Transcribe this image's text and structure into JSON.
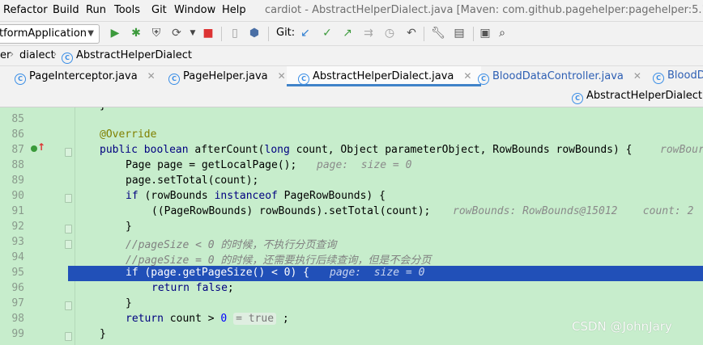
{
  "menu": [
    "Refactor",
    "Build",
    "Run",
    "Tools",
    "Git",
    "Window",
    "Help"
  ],
  "title": "cardiot - AbstractHelperDialect.java [Maven: com.github.pagehelper:pagehelper:5.1.4]",
  "toolbar": {
    "run_config": "tformApplication",
    "git_label": "Git:"
  },
  "breadcrumb": [
    "er",
    "dialect",
    "AbstractHelperDialect"
  ],
  "tabs": [
    {
      "label": "PageInterceptor.java"
    },
    {
      "label": "PageHelper.java"
    },
    {
      "label": "AbstractHelperDialect.java"
    },
    {
      "label": "BloodDataController.java"
    },
    {
      "label": "BloodD"
    }
  ],
  "subbar_file": "AbstractHelperDialect.cla",
  "editor": {
    "line_numbers": [
      "85",
      "86",
      "87",
      "88",
      "89",
      "90",
      "91",
      "92",
      "93",
      "94",
      "95",
      "96",
      "97",
      "98",
      "99"
    ],
    "lines": {
      "l86_ann": "@Override",
      "l87_a": "public boolean",
      "l87_b": " afterCount(",
      "l87_c": "long",
      "l87_d": " count, Object parameterObject, RowBounds rowBounds) {",
      "l87_hint": "rowBour",
      "l88": "Page page = getLocalPage();",
      "l88_hint": "page:  size = 0",
      "l89": "page.setTotal(count);",
      "l90_kw": "if",
      "l90_a": " (rowBounds ",
      "l90_kw2": "instanceof",
      "l90_b": " PageRowBounds) {",
      "l91": "((PageRowBounds) rowBounds).setTotal(count);",
      "l91_hint": "rowBounds: RowBounds@15012    count: 2",
      "l92": "}",
      "l93_cmt": "//pageSize < 0 的时候，不执行分页查询",
      "l94_cmt": "//pageSize = 0 的时候，还需要执行后续查询，但是不会分页",
      "l95": "if (page.getPageSize() < 0) {",
      "l95_hint": "page:  size = 0",
      "l96_kw": "return false",
      "l96_end": ";",
      "l97": "}",
      "l98_kw": "return",
      "l98_a": " count > ",
      "l98_num": "0",
      "l98_inlay": "= true",
      "l98_end": " ;",
      "l99": "}"
    }
  },
  "watermark": "CSDN @JohnJary",
  "colors": {
    "editor_bg": "#c7edcc",
    "highlight": "#2150b8",
    "keyword": "#000080",
    "annotation": "#808000"
  }
}
